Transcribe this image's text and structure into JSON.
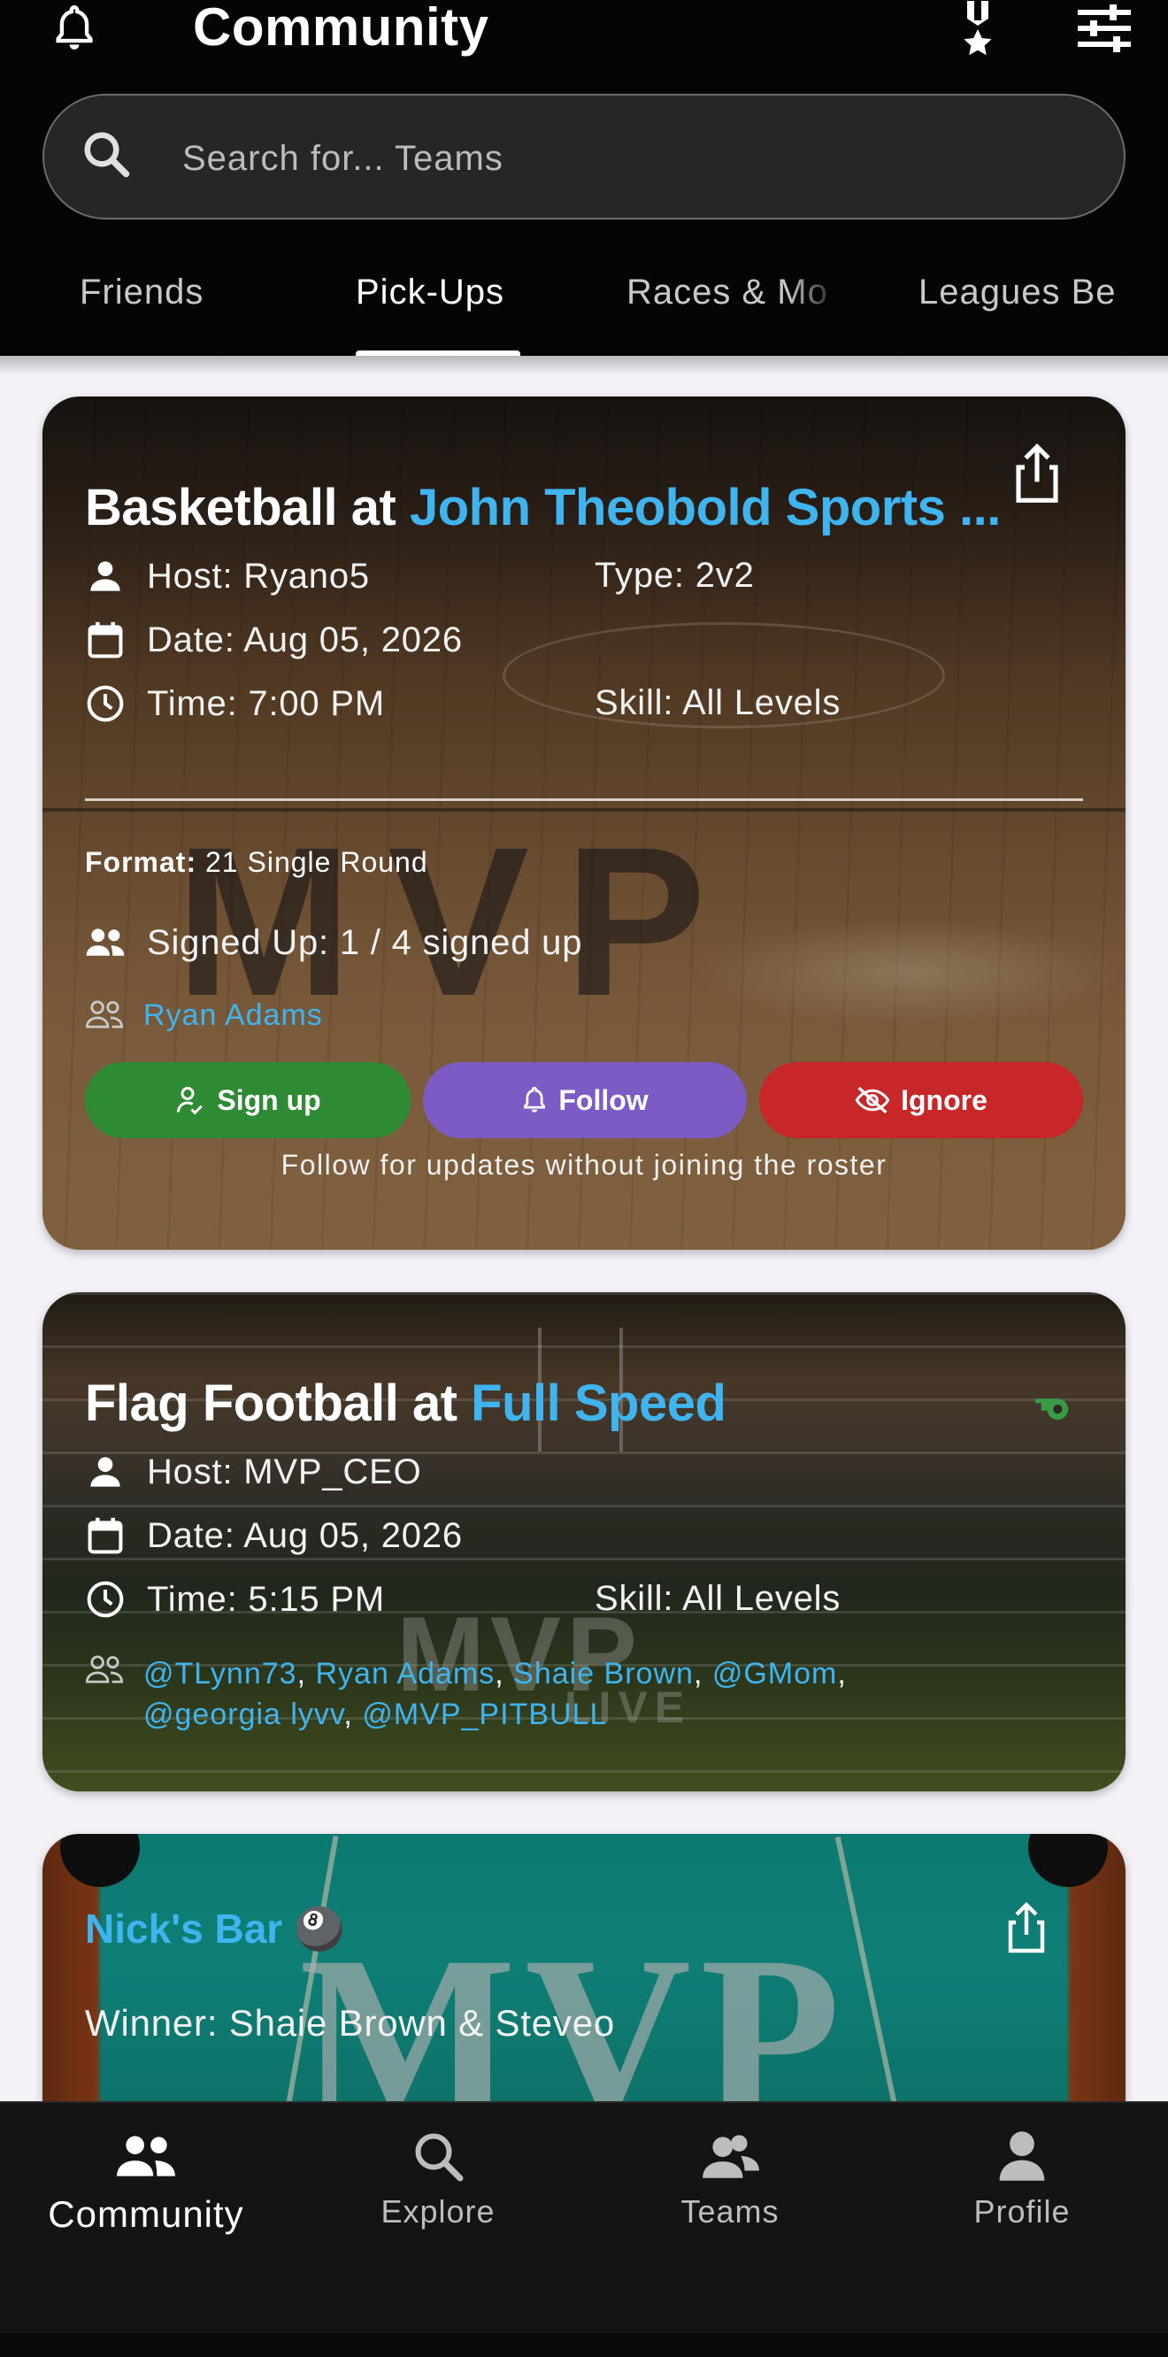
{
  "header": {
    "title": "Community",
    "bell_icon": "bell-icon",
    "medal_icon": "medal-icon",
    "filter_icon": "sliders-icon"
  },
  "search": {
    "placeholder": "Search for... Teams",
    "icon": "search-icon"
  },
  "tabs": [
    {
      "label": "Friends"
    },
    {
      "label": "Pick-Ups",
      "active": true
    },
    {
      "label": "Races & Mo"
    },
    {
      "label": "Leagues Be"
    }
  ],
  "cards": [
    {
      "title_prefix": "Basketball at ",
      "title_venue": "John Theobold Sports ...",
      "host": "Host: Ryano5",
      "type": "Type: 2v2",
      "date": "Date: Aug 05, 2026",
      "time": "Time: 7:00 PM",
      "skill": "Skill: All Levels",
      "format_label": "Format:",
      "format_value": " 21 Single Round",
      "signed_up": "Signed Up: 1 / 4 signed up",
      "participants": [
        "Ryan Adams"
      ],
      "buttons": {
        "sign_up": "Sign up",
        "follow": "Follow",
        "ignore": "Ignore"
      },
      "hint": "Follow for updates without joining the roster",
      "background_watermark": "MVP"
    },
    {
      "title_prefix": "Flag Football at ",
      "title_venue": "Full Speed",
      "host": "Host: MVP_CEO",
      "date": "Date: Aug 05, 2026",
      "time": "Time: 5:15 PM",
      "skill": "Skill: All Levels",
      "participants": [
        "@TLynn73",
        "Ryan Adams",
        "Shaie Brown",
        "@GMom",
        "@georgia lyvv",
        "@MVP_PITBULL"
      ],
      "background_watermark": "MVP",
      "background_watermark_sub": "LIVE",
      "badge_icon": "whistle-icon"
    },
    {
      "title": "Nick's Bar",
      "title_emoji": "🎱",
      "winner": "Winner: Shaie Brown & Steveo",
      "background_watermark": "MVP"
    }
  ],
  "bottom_nav": [
    {
      "label": "Community",
      "icon": "community-icon",
      "active": true
    },
    {
      "label": "Explore",
      "icon": "search-icon"
    },
    {
      "label": "Teams",
      "icon": "teams-icon"
    },
    {
      "label": "Profile",
      "icon": "profile-icon"
    }
  ],
  "colors": {
    "accent_blue": "#3fb4ef",
    "sign_up_green": "#2e8b34",
    "follow_purple": "#7c5cc4",
    "ignore_red": "#c8272a",
    "whistle_green": "#3a9a46"
  }
}
